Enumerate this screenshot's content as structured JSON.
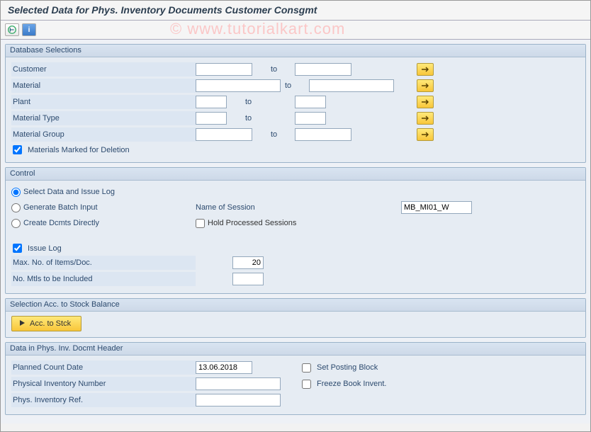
{
  "watermark": "© www.tutorialkart.com",
  "title": "Selected Data for Phys. Inventory Documents Customer Consgmt",
  "toolbar": {
    "execute_icon": "execute",
    "info_icon": "info"
  },
  "groups": {
    "db": {
      "title": "Database Selections",
      "rows": {
        "customer": {
          "label": "Customer",
          "from": "",
          "to_label": "to",
          "to": ""
        },
        "material": {
          "label": "Material",
          "from": "",
          "to_label": "to",
          "to": ""
        },
        "plant": {
          "label": "Plant",
          "from": "",
          "to_label": "to",
          "to": ""
        },
        "material_type": {
          "label": "Material Type",
          "from": "",
          "to_label": "to",
          "to": ""
        },
        "material_group": {
          "label": "Material Group",
          "from": "",
          "to_label": "to",
          "to": ""
        }
      },
      "deletion_checkbox": {
        "label": "Materials Marked for Deletion",
        "checked": true
      }
    },
    "control": {
      "title": "Control",
      "radios": {
        "select_log": {
          "label": "Select Data and Issue Log",
          "checked": true
        },
        "batch_input": {
          "label": "Generate Batch Input",
          "checked": false
        },
        "direct": {
          "label": "Create Dcmts Directly",
          "checked": false
        }
      },
      "session_label": "Name of Session",
      "session_value": "MB_MI01_W",
      "hold_sessions": {
        "label": "Hold Processed Sessions",
        "checked": false
      },
      "issue_log": {
        "label": "Issue Log",
        "checked": true
      },
      "max_items": {
        "label": "Max. No. of Items/Doc.",
        "value": "20"
      },
      "no_mtls": {
        "label": "No. Mtls to be Included",
        "value": ""
      }
    },
    "stock": {
      "title": "Selection Acc. to Stock Balance",
      "button_label": "Acc. to Stck"
    },
    "header": {
      "title": "Data in Phys. Inv. Docmt Header",
      "planned_date": {
        "label": "Planned Count Date",
        "value": "13.06.2018"
      },
      "phys_inv_no": {
        "label": "Physical Inventory Number",
        "value": ""
      },
      "phys_inv_ref": {
        "label": "Phys. Inventory Ref.",
        "value": ""
      },
      "set_posting": {
        "label": "Set Posting Block",
        "checked": false
      },
      "freeze_book": {
        "label": "Freeze Book Invent.",
        "checked": false
      }
    }
  }
}
